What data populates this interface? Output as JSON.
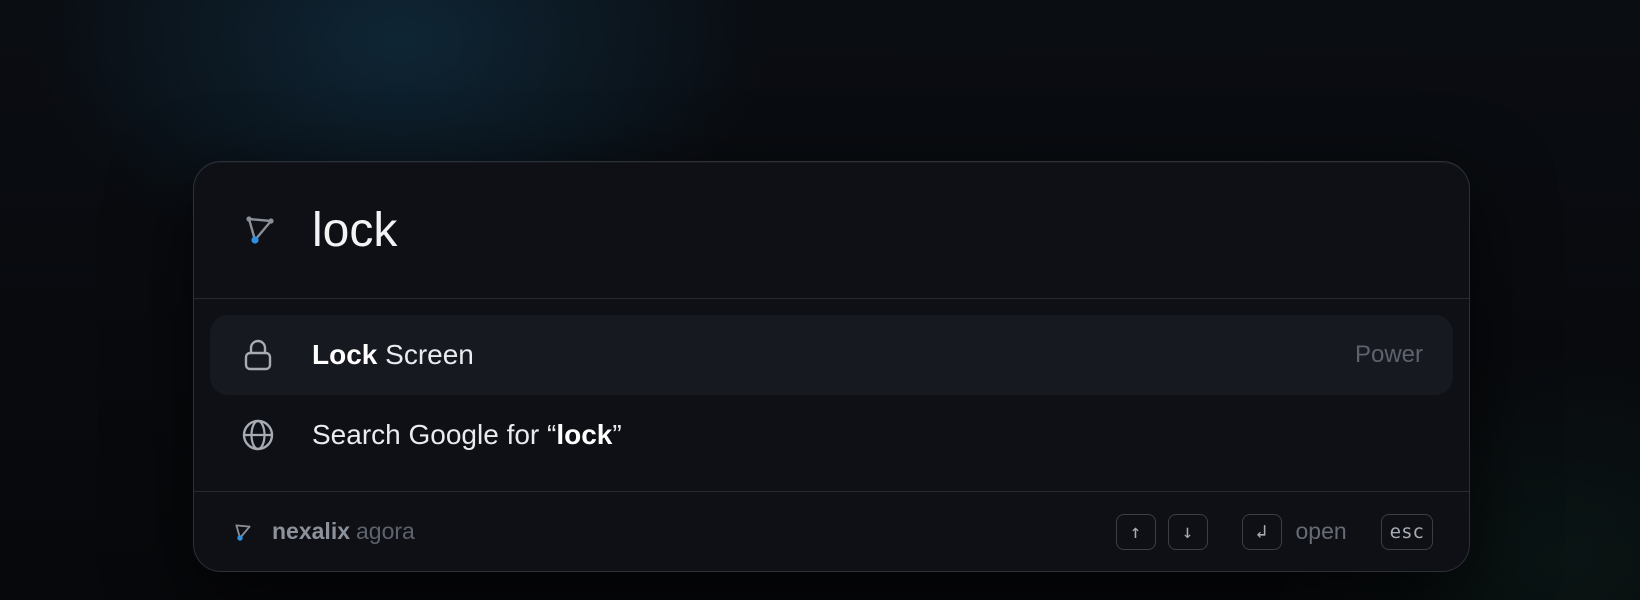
{
  "search": {
    "value": "lock",
    "logo_icon": "nexalix-logo-icon"
  },
  "results": [
    {
      "icon": "lock-icon",
      "label_bold": "Lock",
      "label_rest": " Screen",
      "category": "Power",
      "selected": true
    },
    {
      "icon": "globe-icon",
      "label_prefix": "Search Google for “",
      "label_bold": "lock",
      "label_suffix": "”",
      "category": "",
      "selected": false
    }
  ],
  "footer": {
    "brand_name": "nexalix",
    "brand_product": "agora",
    "hints": {
      "up_key": "↑",
      "down_key": "↓",
      "enter_key": "↲",
      "enter_label": "open",
      "escape_key": "esc"
    }
  },
  "colors": {
    "accent": "#2f8fe0",
    "panel": "#0e1015",
    "selected_row": "#161920"
  }
}
